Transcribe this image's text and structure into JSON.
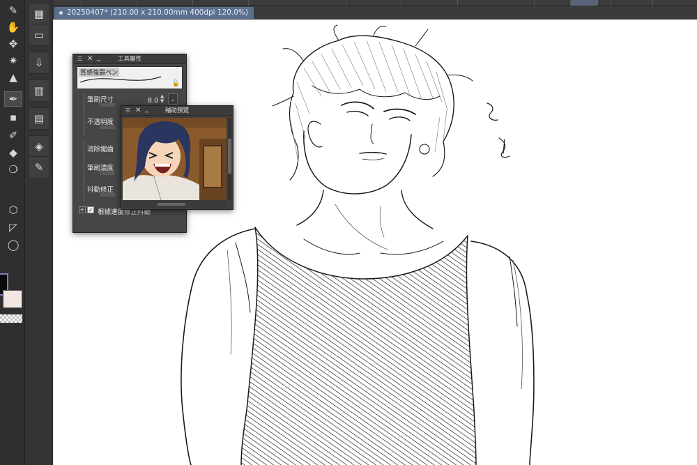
{
  "document_tab": {
    "title": "20250407* (210.00 x 210.00mm 400dpi 120.0%)"
  },
  "tools": [
    {
      "name": "pen-tool-icon",
      "glyph": "✎"
    },
    {
      "name": "hand-tool-icon",
      "glyph": "✋"
    },
    {
      "name": "move-tool-icon",
      "glyph": "✥"
    },
    {
      "name": "sparkle-tool-icon",
      "glyph": "✷"
    },
    {
      "name": "cake-tool-icon",
      "glyph": "▲"
    },
    {
      "name": "ink-pen-tool-icon",
      "glyph": "✒"
    },
    {
      "name": "square-dot-tool-icon",
      "glyph": "▪"
    },
    {
      "name": "brush-tool-icon",
      "glyph": "✐"
    },
    {
      "name": "fill-tool-icon",
      "glyph": "◆"
    },
    {
      "name": "blend-tool-icon",
      "glyph": "❍"
    },
    {
      "name": "hexagon-tool-icon",
      "glyph": "⬡"
    },
    {
      "name": "triangle-ruler-tool-icon",
      "glyph": "◸"
    },
    {
      "name": "speech-bubble-tool-icon",
      "glyph": "◯"
    }
  ],
  "commands": [
    {
      "name": "grid-icon",
      "glyph": "▦"
    },
    {
      "name": "layer-icon",
      "glyph": "▭"
    },
    {
      "name": "import-icon",
      "glyph": "⇩"
    },
    {
      "name": "film-icon",
      "glyph": "▥"
    },
    {
      "name": "panel-icon",
      "glyph": "▤"
    },
    {
      "name": "cube-icon",
      "glyph": "◈"
    },
    {
      "name": "edit-layer-icon",
      "glyph": "✎"
    }
  ],
  "tool_properties": {
    "title": "工具屬性",
    "brush_name": "質感強弱ペン",
    "brush_size_label": "筆刷尺寸",
    "brush_size_value": "8.0",
    "opacity_label": "不透明度",
    "antialias_label": "消除鋸齒",
    "density_label": "筆刷濃度",
    "stabilization_label": "抖動修正",
    "speed_checkbox_label": "根據速度修正抖動",
    "speed_checkbox_checked": true
  },
  "reference_panel": {
    "title": "輔助預覽"
  },
  "colors": {
    "main": "#0a0a0a",
    "sub": "#f2e6e2",
    "tab_accent": "#5b6f8f"
  }
}
